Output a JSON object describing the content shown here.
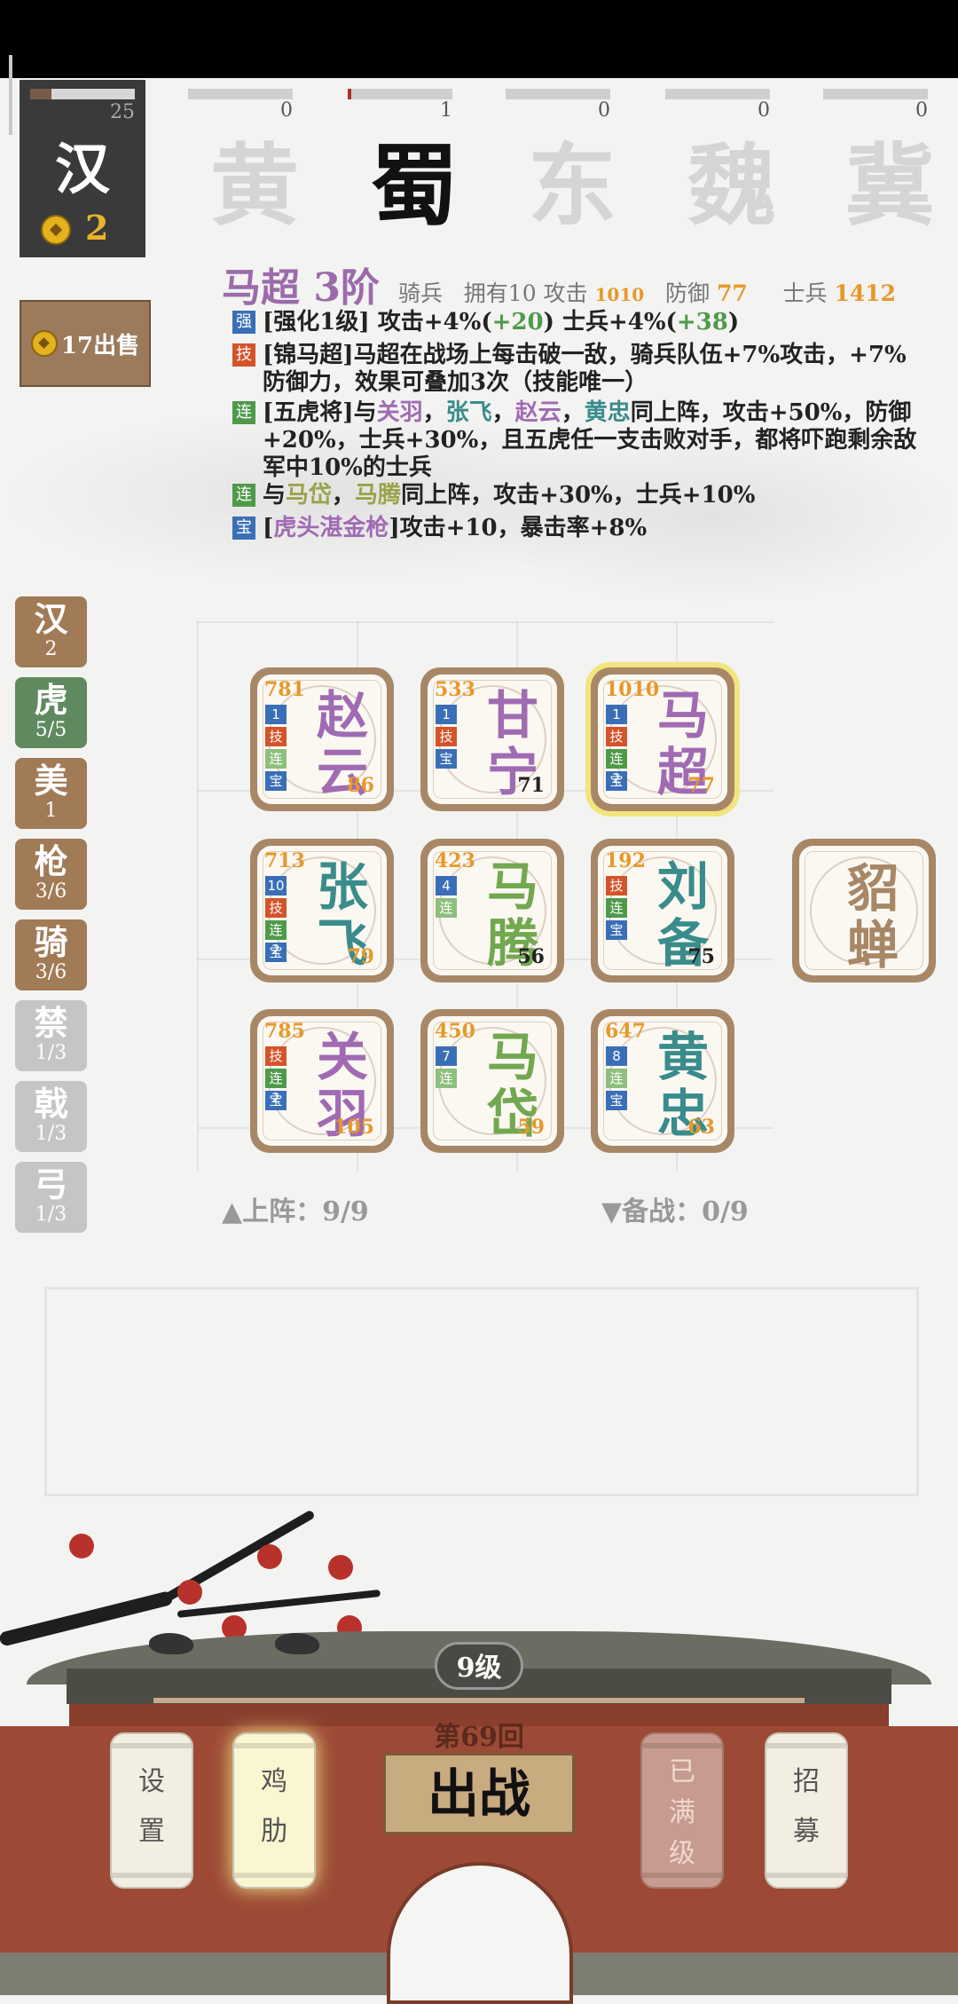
{
  "player": {
    "faction": "汉",
    "level": "25",
    "gold": "2",
    "xp_fraction": 0.2
  },
  "sell_label": "17出售",
  "kingdoms": [
    {
      "char": "黄",
      "count": "0",
      "bar_fill": 0,
      "active": false
    },
    {
      "char": "蜀",
      "count": "1",
      "bar_fill": 0.03,
      "active": true
    },
    {
      "char": "东",
      "count": "0",
      "bar_fill": 0,
      "active": false
    },
    {
      "char": "魏",
      "count": "0",
      "bar_fill": 0,
      "active": false
    },
    {
      "char": "冀",
      "count": "0",
      "bar_fill": 0,
      "active": false
    }
  ],
  "hero": {
    "title": "马超 3阶",
    "class": "骑兵",
    "own_label": "拥有10 攻击",
    "attack": "1010",
    "defense_label": "防御",
    "defense": "77",
    "troops_label": "士兵",
    "troops": "1412",
    "traits": [
      {
        "tag": "强",
        "parts": [
          "[强化1级] 攻击+4%(",
          "+20",
          ") 士兵+4%(",
          "+38",
          ")"
        ]
      },
      {
        "tag": "技",
        "text": "[锦马超]马超在战场上每击破一敌，骑兵队伍+7%攻击，+7%防御力，效果可叠加3次（技能唯一）"
      },
      {
        "tag": "连",
        "parts": [
          "[五虎将]与",
          "关羽",
          "，",
          "张飞",
          "，",
          "赵云",
          "，",
          "黄忠",
          "同上阵，攻击+50%，防御+20%，士兵+30%，且五虎任一支击败对手，都将吓跑剩余敌军中10%的士兵"
        ]
      },
      {
        "tag": "连",
        "parts": [
          "与",
          "马岱",
          "，",
          "马腾",
          "同上阵，攻击+30%，士兵+10%"
        ]
      },
      {
        "tag": "宝",
        "parts": [
          "[",
          "虎头湛金枪",
          "]攻击+10，暴击率+8%"
        ]
      }
    ]
  },
  "filters": [
    {
      "char": "汉",
      "count": "2"
    },
    {
      "char": "虎",
      "count": "5/5"
    },
    {
      "char": "美",
      "count": "1"
    },
    {
      "char": "枪",
      "count": "3/6"
    },
    {
      "char": "骑",
      "count": "3/6"
    },
    {
      "char": "禁",
      "count": "1/3"
    },
    {
      "char": "戟",
      "count": "1/3"
    },
    {
      "char": "弓",
      "count": "1/3"
    }
  ],
  "cards": [
    {
      "name": "赵云",
      "atk": "781",
      "def": "86",
      "badges": [
        "1",
        "技",
        "连",
        "宝"
      ]
    },
    {
      "name": "甘宁",
      "atk": "533",
      "def": "71",
      "badges": [
        "1",
        "技",
        "宝"
      ]
    },
    {
      "name": "马超",
      "atk": "1010",
      "def": "77",
      "badges": [
        "1",
        "技",
        "连2",
        "宝"
      ]
    },
    {
      "name": "张飞",
      "atk": "713",
      "def": "79",
      "badges": [
        "10",
        "技",
        "连2",
        "宝"
      ]
    },
    {
      "name": "马腾",
      "atk": "423",
      "def": "56",
      "badges": [
        "4",
        "连"
      ]
    },
    {
      "name": "刘备",
      "atk": "192",
      "def": "75",
      "badges": [
        "技",
        "连",
        "宝"
      ]
    },
    {
      "name": "貂蝉"
    },
    {
      "name": "关羽",
      "atk": "785",
      "def": "105",
      "badges": [
        "技",
        "连2",
        "宝"
      ]
    },
    {
      "name": "马岱",
      "atk": "450",
      "def": "59",
      "badges": [
        "7",
        "连"
      ]
    },
    {
      "name": "黄忠",
      "atk": "647",
      "def": "63",
      "badges": [
        "8",
        "连",
        "宝"
      ]
    }
  ],
  "deploy": {
    "label": "上阵：9/9",
    "reserve": "备战：0/9"
  },
  "bottom": {
    "level": "9级",
    "round": "第69回",
    "fight": "出战",
    "settings": "设置",
    "cheer": "鸡肋",
    "maxed": "已满级",
    "recruit": "招募"
  },
  "colors": {
    "accent_purple": "#a06bb3",
    "accent_gold": "#e7982a",
    "wall_red": "#9c4a35"
  }
}
